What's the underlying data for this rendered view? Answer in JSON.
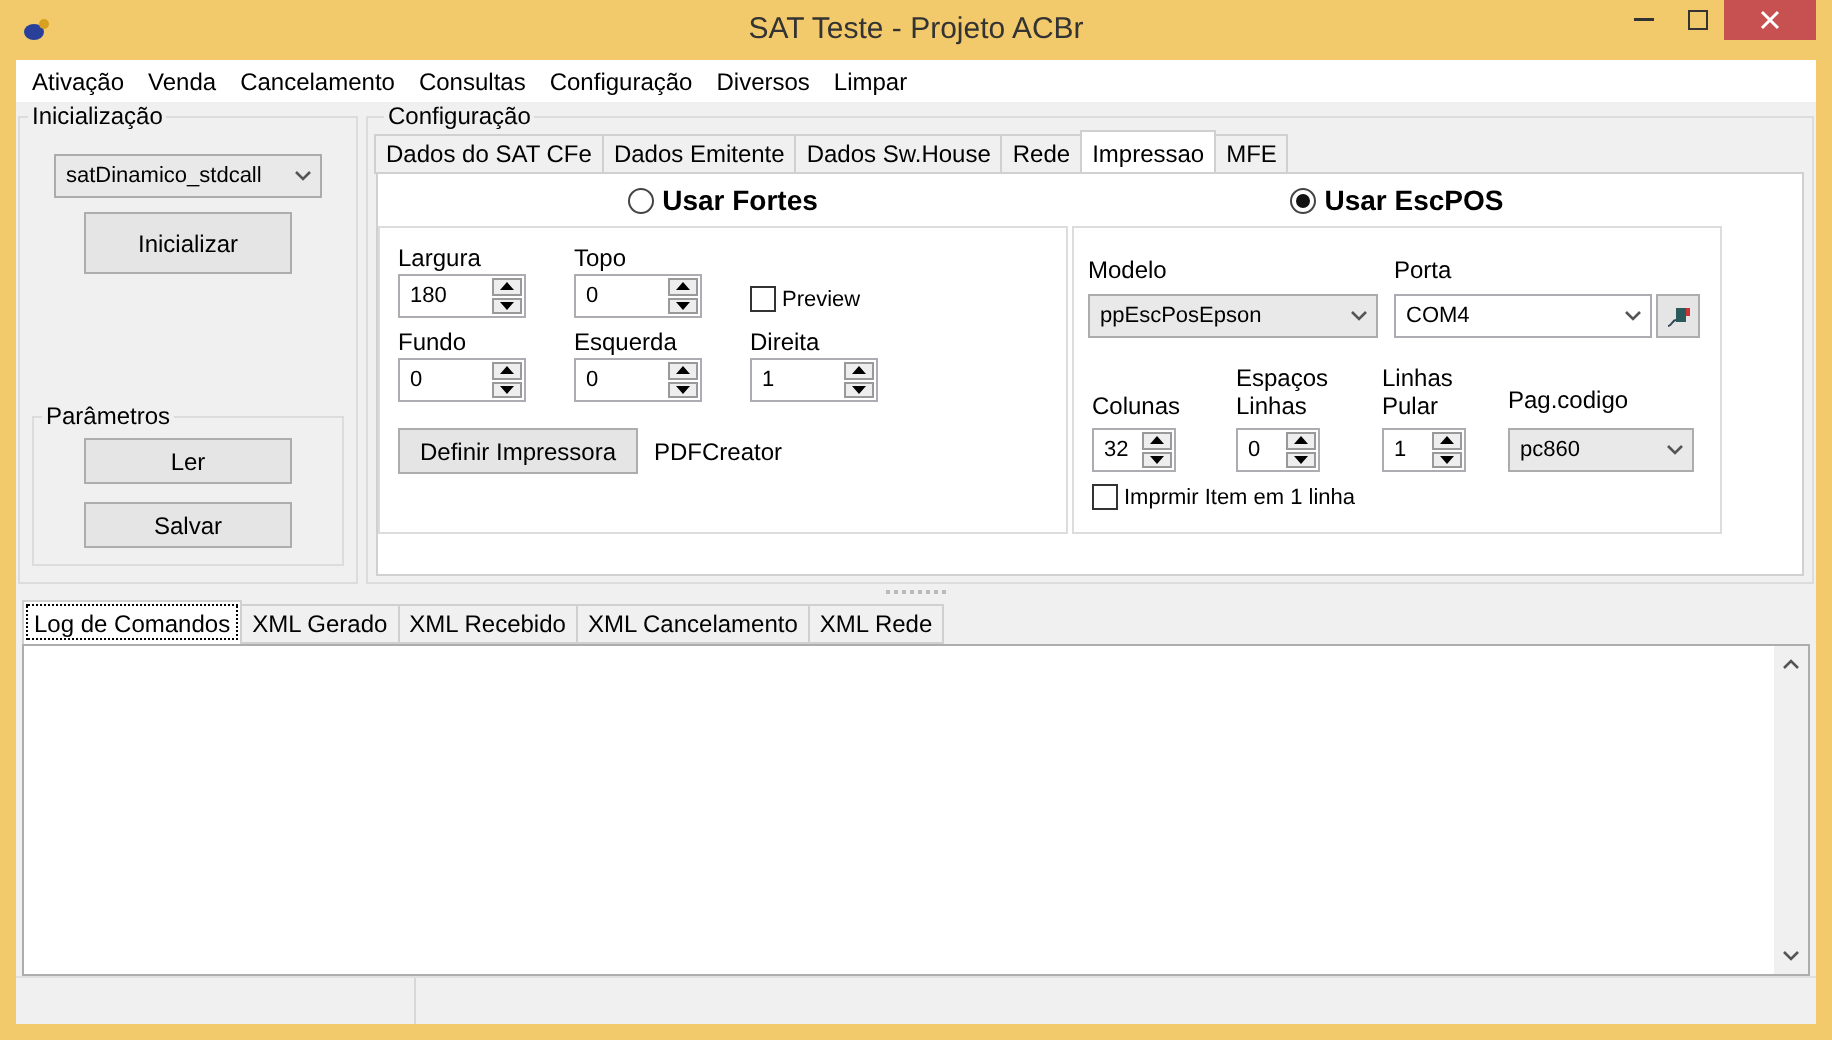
{
  "window": {
    "title": "SAT Teste - Projeto ACBr"
  },
  "menu": [
    "Ativação",
    "Venda",
    "Cancelamento",
    "Consultas",
    "Configuração",
    "Diversos",
    "Limpar"
  ],
  "inicializacao": {
    "title": "Inicialização",
    "library": "satDinamico_stdcall",
    "button": "Inicializar",
    "parametros": {
      "title": "Parâmetros",
      "buttons": [
        "Ler",
        "Salvar"
      ]
    }
  },
  "configuracao": {
    "title": "Configuração",
    "tabs": [
      {
        "label": "Dados do SAT CFe",
        "selected": false
      },
      {
        "label": "Dados Emitente",
        "selected": false
      },
      {
        "label": "Dados Sw.House",
        "selected": false
      },
      {
        "label": "Rede",
        "selected": false
      },
      {
        "label": "Impressao",
        "selected": true
      },
      {
        "label": "MFE",
        "selected": false
      }
    ],
    "fortes": {
      "label": "Usar Fortes",
      "selected": false,
      "fields": [
        {
          "label": "Largura",
          "value": "180"
        },
        {
          "label": "Topo",
          "value": "0"
        },
        {
          "label": "Fundo",
          "value": "0"
        },
        {
          "label": "Esquerda",
          "value": "0"
        },
        {
          "label": "Direita",
          "value": "1"
        }
      ],
      "preview": {
        "label": "Preview",
        "checked": false
      },
      "button": "Definir Impressora",
      "printer": "PDFCreator"
    },
    "escpos": {
      "label": "Usar EscPOS",
      "selected": true,
      "modelo": {
        "label": "Modelo",
        "value": "ppEscPosEpson"
      },
      "porta": {
        "label": "Porta",
        "value": "COM4"
      },
      "spinners": [
        {
          "label": "Colunas",
          "value": "32"
        },
        {
          "label": "Espaços Linhas",
          "value": "0"
        },
        {
          "label": "Linhas Pular",
          "value": "1"
        }
      ],
      "pagina_codigo": {
        "label": "Pag.codigo",
        "value": "pc860"
      },
      "item_uma_linha": {
        "label": "Imprmir Item em 1 linha",
        "checked": false
      }
    }
  },
  "log_tabs": [
    {
      "label": "Log de Comandos",
      "selected": true
    },
    {
      "label": "XML Gerado",
      "selected": false
    },
    {
      "label": "XML Recebido",
      "selected": false
    },
    {
      "label": "XML Cancelamento",
      "selected": false
    },
    {
      "label": "XML Rede",
      "selected": false
    }
  ]
}
